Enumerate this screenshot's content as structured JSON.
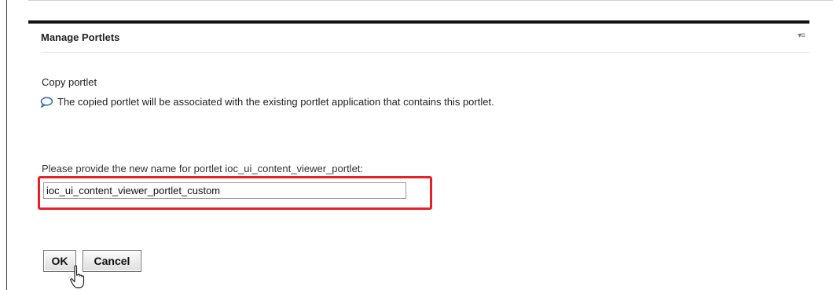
{
  "portlet": {
    "title": "Manage Portlets",
    "menu_icon": "menu-arrow-icon"
  },
  "copy": {
    "heading": "Copy portlet",
    "info_icon": "speech-bubble-icon",
    "info_text": "The copied portlet will be associated with the existing portlet application that contains this portlet.",
    "prompt_label": "Please provide the new name for portlet ioc_ui_content_viewer_portlet:",
    "name_value": "ioc_ui_content_viewer_portlet_custom"
  },
  "buttons": {
    "ok_label": "OK",
    "cancel_label": "Cancel"
  },
  "colors": {
    "highlight": "#e8202a",
    "info_icon": "#3b6fb6"
  }
}
